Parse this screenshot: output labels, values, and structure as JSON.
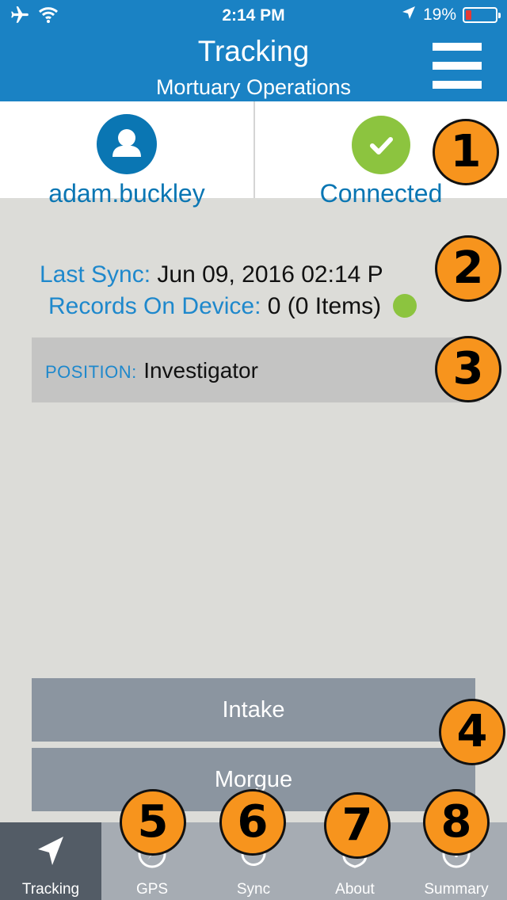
{
  "status_bar": {
    "time": "2:14 PM",
    "battery": "19%",
    "battery_level": 0.19,
    "icons": [
      "airplane-icon",
      "wifi-icon",
      "location-arrow-icon",
      "battery-icon"
    ]
  },
  "header": {
    "title": "Tracking",
    "subtitle": "Mortuary Operations",
    "menu_icon": "hamburger-menu-icon"
  },
  "user_panel": {
    "username": "adam.buckley",
    "icon": "user-icon"
  },
  "connection_panel": {
    "status": "Connected",
    "icon": "check-icon"
  },
  "sync": {
    "last_sync_label": "Last Sync:",
    "last_sync_value": "Jun 09, 2016 02:14 P",
    "records_label": "Records On Device:",
    "records_value": "0 (0 Items)",
    "indicator_color": "#8cc43f"
  },
  "position": {
    "label": "POSITION:",
    "value": "Investigator"
  },
  "actions": {
    "intake_label": "Intake",
    "morgue_label": "Morgue"
  },
  "tabs": [
    {
      "label": "Tracking",
      "icon": "navigation-arrow-icon",
      "active": true
    },
    {
      "label": "GPS",
      "icon": "compass-icon",
      "active": false
    },
    {
      "label": "Sync",
      "icon": "sync-icon",
      "active": false
    },
    {
      "label": "About",
      "icon": "shield-icon",
      "active": false
    },
    {
      "label": "Summary",
      "icon": "info-icon",
      "active": false
    }
  ],
  "markers": [
    "1",
    "2",
    "3",
    "4",
    "5",
    "6",
    "7",
    "8"
  ],
  "colors": {
    "header_blue": "#1a82c4",
    "label_blue": "#1e88cc",
    "connected_green": "#8cc43f",
    "marker_orange": "#f7941d",
    "button_gray": "#8b95a0",
    "tabbar_gray": "#a6acb3",
    "tab_active": "#535c66"
  }
}
